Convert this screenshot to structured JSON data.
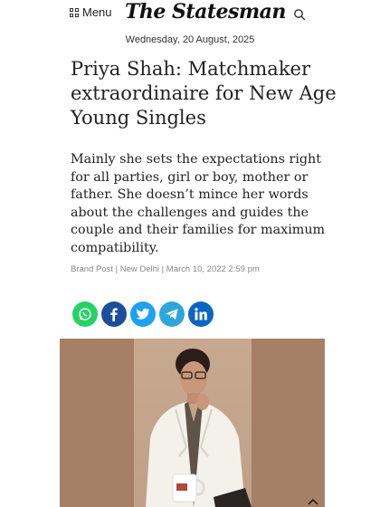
{
  "header": {
    "menu_label": "Menu",
    "logo_text": "The Statesman",
    "icons": {
      "menu": "grid-icon",
      "search": "search-icon"
    }
  },
  "date": "Wednesday, 20 August, 2025",
  "article": {
    "headline": "Priya Shah: Matchmaker extraordinaire for New Age Young Singles",
    "summary": "Mainly she sets the expectations right for all parties, girl or boy, mother or father. She doesn’t mince her words about the challenges and guides the couple and their families for maximum compatibility.",
    "byline": "Brand Post | New Delhi | March 10, 2022 2:59 pm"
  },
  "share": [
    {
      "name": "whatsapp",
      "icon": "whatsapp-icon",
      "color": "#25d366"
    },
    {
      "name": "facebook",
      "icon": "facebook-icon",
      "color": "#1b4f9b"
    },
    {
      "name": "twitter",
      "icon": "twitter-icon",
      "color": "#1da1f2"
    },
    {
      "name": "telegram",
      "icon": "telegram-icon",
      "color": "#2ea6da"
    },
    {
      "name": "linkedin",
      "icon": "linkedin-icon",
      "color": "#0a66c2"
    }
  ],
  "scroll_top_icon": "chevron-up-icon"
}
